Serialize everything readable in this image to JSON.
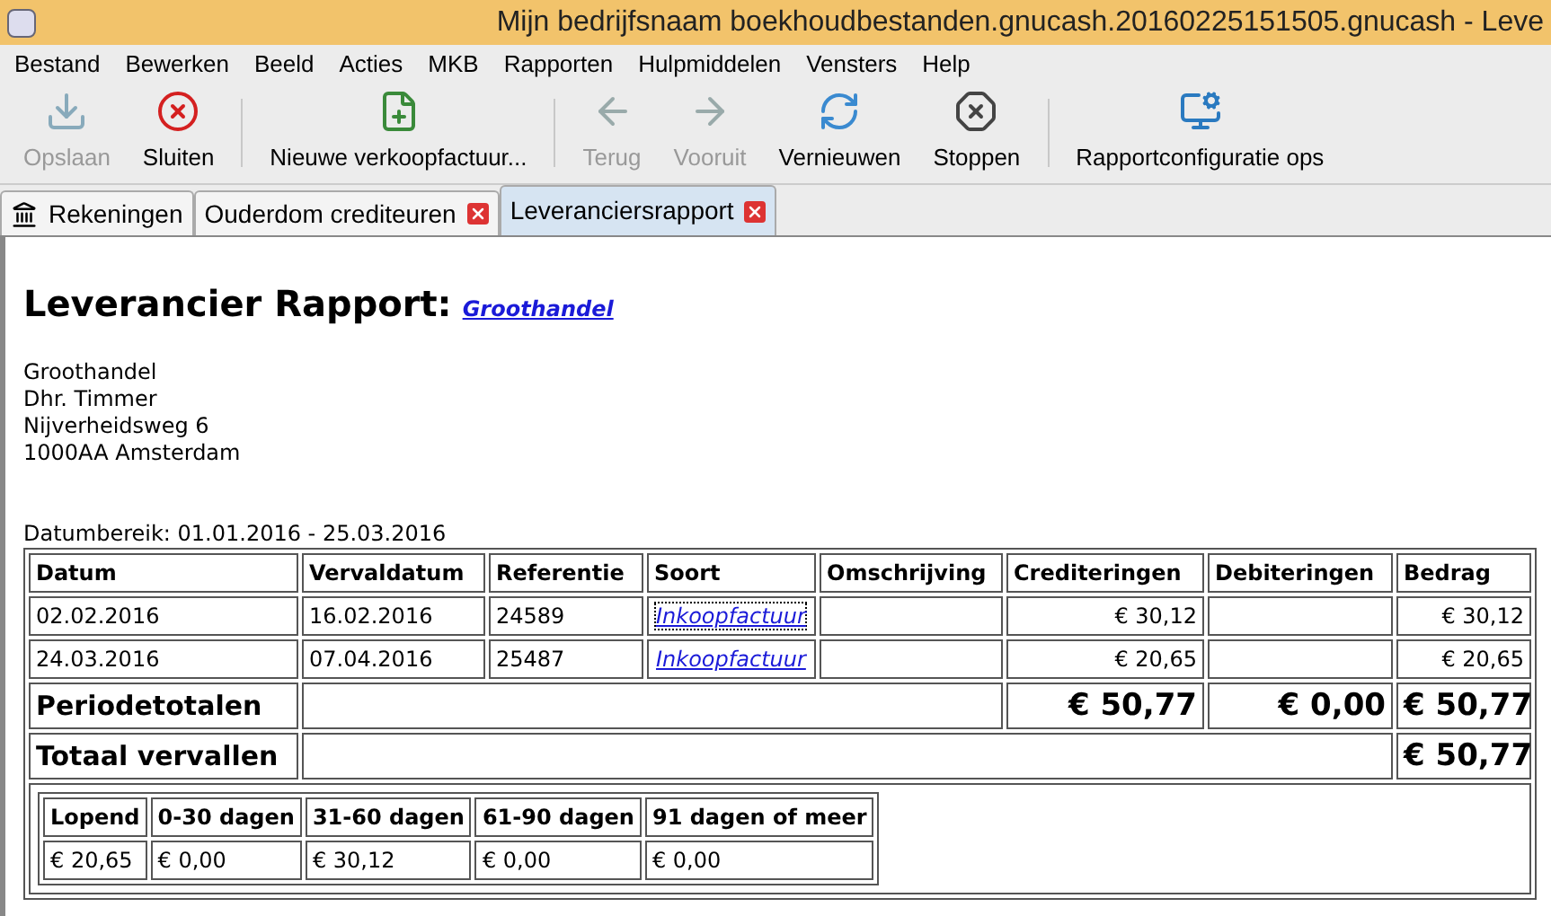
{
  "window": {
    "title": "Mijn bedrijfsnaam boekhoudbestanden.gnucash.20160225151505.gnucash - Leve"
  },
  "menu": [
    "Bestand",
    "Bewerken",
    "Beeld",
    "Acties",
    "MKB",
    "Rapporten",
    "Hulpmiddelen",
    "Vensters",
    "Help"
  ],
  "toolbar": [
    {
      "kind": "save",
      "label": "Opslaan",
      "disabled": true
    },
    {
      "kind": "close",
      "label": "Sluiten",
      "disabled": false
    },
    {
      "kind": "separator"
    },
    {
      "kind": "new-invoice",
      "label": "Nieuwe verkoopfactuur...",
      "disabled": false
    },
    {
      "kind": "separator"
    },
    {
      "kind": "back",
      "label": "Terug",
      "disabled": true
    },
    {
      "kind": "forward",
      "label": "Vooruit",
      "disabled": true
    },
    {
      "kind": "refresh",
      "label": "Vernieuwen",
      "disabled": false
    },
    {
      "kind": "stop",
      "label": "Stoppen",
      "disabled": false
    },
    {
      "kind": "separator"
    },
    {
      "kind": "options",
      "label": "Rapportconfiguratie ops",
      "disabled": false
    }
  ],
  "tabs": [
    {
      "label": "Rekeningen",
      "kind": "accounts",
      "selected": false,
      "closable": false
    },
    {
      "label": "Ouderdom crediteuren",
      "kind": "report",
      "selected": false,
      "closable": true
    },
    {
      "label": "Leveranciersrapport",
      "kind": "report",
      "selected": true,
      "closable": true
    }
  ],
  "report": {
    "title": "Leverancier Rapport:",
    "vendor_link": "Groothandel",
    "address": [
      "Groothandel",
      "Dhr. Timmer",
      "Nijverheidsweg 6",
      "1000AA Amsterdam"
    ],
    "date_range": "Datumbereik: 01.01.2016 - 25.03.2016",
    "table": {
      "columns": [
        "Datum",
        "Vervaldatum",
        "Referentie",
        "Soort",
        "Omschrijving",
        "Crediteringen",
        "Debiteringen",
        "Bedrag"
      ],
      "rows": [
        {
          "datum": "02.02.2016",
          "vervaldatum": "16.02.2016",
          "referentie": "24589",
          "soort": "Inkoopfactuur",
          "crediteringen": "€ 30,12",
          "bedrag": "€ 30,12",
          "focused": true
        },
        {
          "datum": "24.03.2016",
          "vervaldatum": "07.04.2016",
          "referentie": "25487",
          "soort": "Inkoopfactuur",
          "crediteringen": "€ 20,65",
          "bedrag": "€ 20,65",
          "focused": false
        }
      ],
      "period_totals": {
        "label": "Periodetotalen",
        "crediteringen": "€ 50,77",
        "debiteringen": "€ 0,00",
        "bedrag": "€ 50,77"
      },
      "total_due": {
        "label": "Totaal vervallen",
        "bedrag": "€ 50,77"
      }
    },
    "aging": {
      "columns": [
        "Lopend",
        "0-30 dagen",
        "31-60 dagen",
        "61-90 dagen",
        "91 dagen of meer"
      ],
      "values": [
        "€ 20,65",
        "€ 0,00",
        "€ 30,12",
        "€ 0,00",
        "€ 0,00"
      ]
    }
  }
}
